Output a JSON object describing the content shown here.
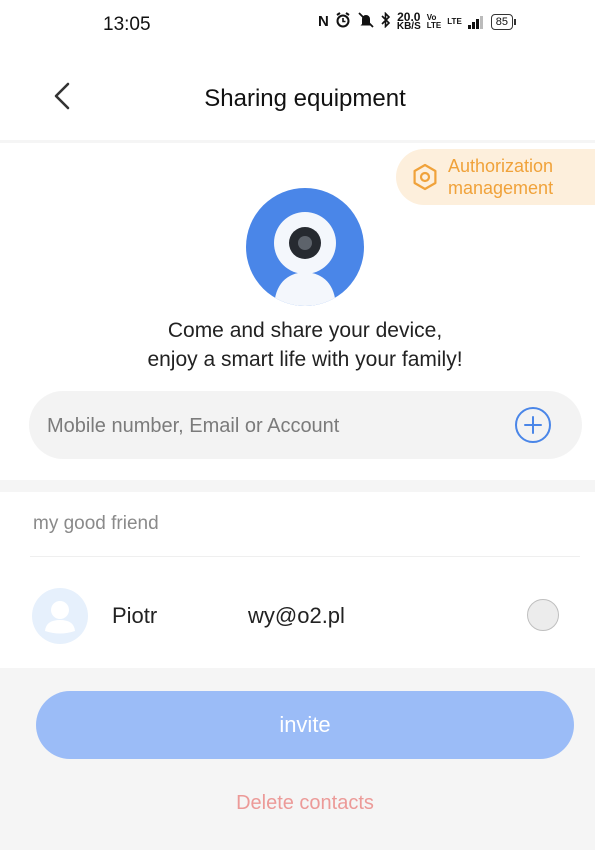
{
  "status_bar": {
    "time": "13:05",
    "nfc": "N",
    "speed_value": "20.0",
    "speed_unit": "KB/S",
    "volte_top": "Vo",
    "volte_bottom": "LTE",
    "network": "LTE",
    "battery": "85"
  },
  "header": {
    "title": "Sharing equipment",
    "back_icon": "chevron-left-icon"
  },
  "authorization": {
    "label": "Authorization management",
    "icon": "hexagon-settings-icon",
    "color": "#f0a23a",
    "background": "#fdefdc"
  },
  "promo": {
    "line1": "Come and share your device,",
    "line2": "enjoy a smart life with your family!"
  },
  "account_input": {
    "placeholder": "Mobile number, Email or Account",
    "value": "",
    "add_icon": "plus-circle-icon"
  },
  "contacts_section": {
    "label": "my good friend",
    "contacts": [
      {
        "name": "Piotr",
        "email": "wy@o2.pl",
        "selected": false
      }
    ]
  },
  "actions": {
    "invite_label": "invite",
    "delete_label": "Delete contacts"
  },
  "colors": {
    "accent_blue": "#4a86e8",
    "invite_button": "#9bbcf7",
    "delete_text": "#ec9a98"
  }
}
